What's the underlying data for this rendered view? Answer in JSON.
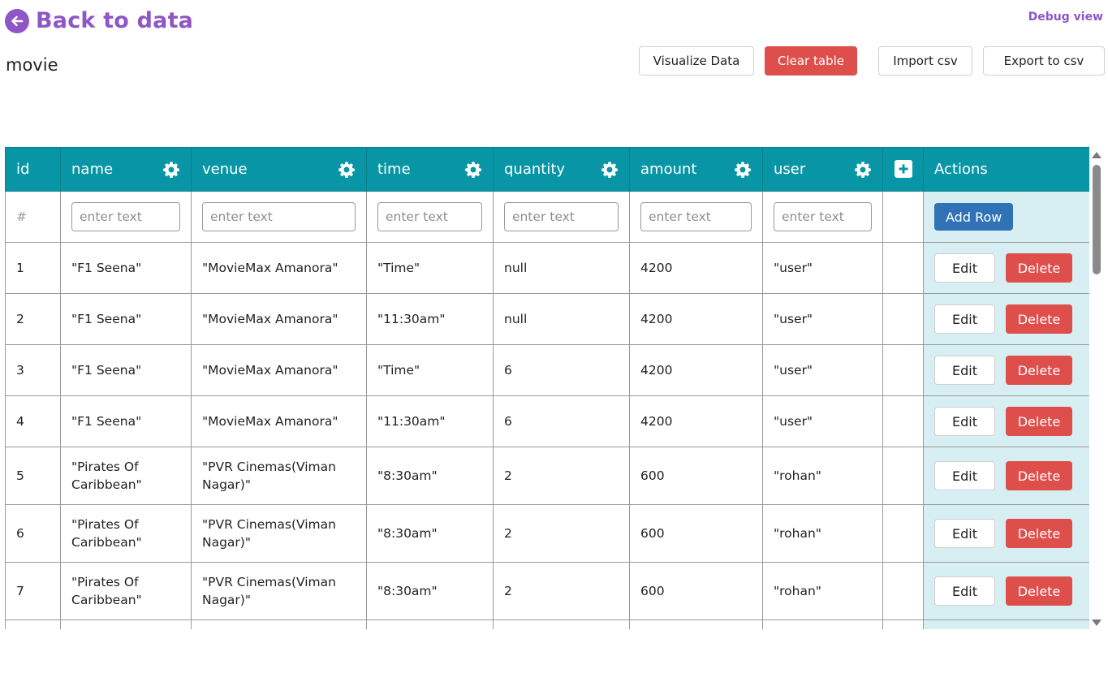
{
  "header": {
    "back_label": "Back to data",
    "debug_label": "Debug view",
    "table_name": "movie"
  },
  "toolbar": {
    "visualize_label": "Visualize Data",
    "clear_label": "Clear table",
    "import_label": "Import csv",
    "export_label": "Export to csv"
  },
  "table": {
    "columns": [
      "id",
      "name",
      "venue",
      "time",
      "quantity",
      "amount",
      "user"
    ],
    "actions_header": "Actions",
    "filter_placeholder": "enter text",
    "filter_id_symbol": "#",
    "add_row_label": "Add Row",
    "edit_label": "Edit",
    "delete_label": "Delete",
    "rows": [
      {
        "id": "1",
        "name": "\"F1 Seena\"",
        "venue": "\"MovieMax Amanora\"",
        "time": "\"Time\"",
        "quantity": "null",
        "amount": "4200",
        "user": "\"user\""
      },
      {
        "id": "2",
        "name": "\"F1 Seena\"",
        "venue": "\"MovieMax Amanora\"",
        "time": "\"11:30am\"",
        "quantity": "null",
        "amount": "4200",
        "user": "\"user\""
      },
      {
        "id": "3",
        "name": "\"F1 Seena\"",
        "venue": "\"MovieMax Amanora\"",
        "time": "\"Time\"",
        "quantity": "6",
        "amount": "4200",
        "user": "\"user\""
      },
      {
        "id": "4",
        "name": "\"F1 Seena\"",
        "venue": "\"MovieMax Amanora\"",
        "time": "\"11:30am\"",
        "quantity": "6",
        "amount": "4200",
        "user": "\"user\""
      },
      {
        "id": "5",
        "name": "\"Pirates Of Caribbean\"",
        "venue": "\"PVR Cinemas(Viman Nagar)\"",
        "time": "\"8:30am\"",
        "quantity": "2",
        "amount": "600",
        "user": "\"rohan\""
      },
      {
        "id": "6",
        "name": "\"Pirates Of Caribbean\"",
        "venue": "\"PVR Cinemas(Viman Nagar)\"",
        "time": "\"8:30am\"",
        "quantity": "2",
        "amount": "600",
        "user": "\"rohan\""
      },
      {
        "id": "7",
        "name": "\"Pirates Of Caribbean\"",
        "venue": "\"PVR Cinemas(Viman Nagar)\"",
        "time": "\"8:30am\"",
        "quantity": "2",
        "amount": "600",
        "user": "\"rohan\""
      },
      {
        "id": "",
        "name": "",
        "venue": "",
        "time": "",
        "quantity": "",
        "amount": "",
        "user": ""
      }
    ]
  },
  "icons": {
    "back": "arrow-left-circle-icon",
    "column_settings": "gear-icon",
    "add_column": "plus-square-icon"
  },
  "colors": {
    "accent_purple": "#8e56c6",
    "header_teal": "#0896a6",
    "actions_bg": "#d7eff2",
    "danger": "#de4e4b",
    "primary_blue": "#2f73b6"
  }
}
